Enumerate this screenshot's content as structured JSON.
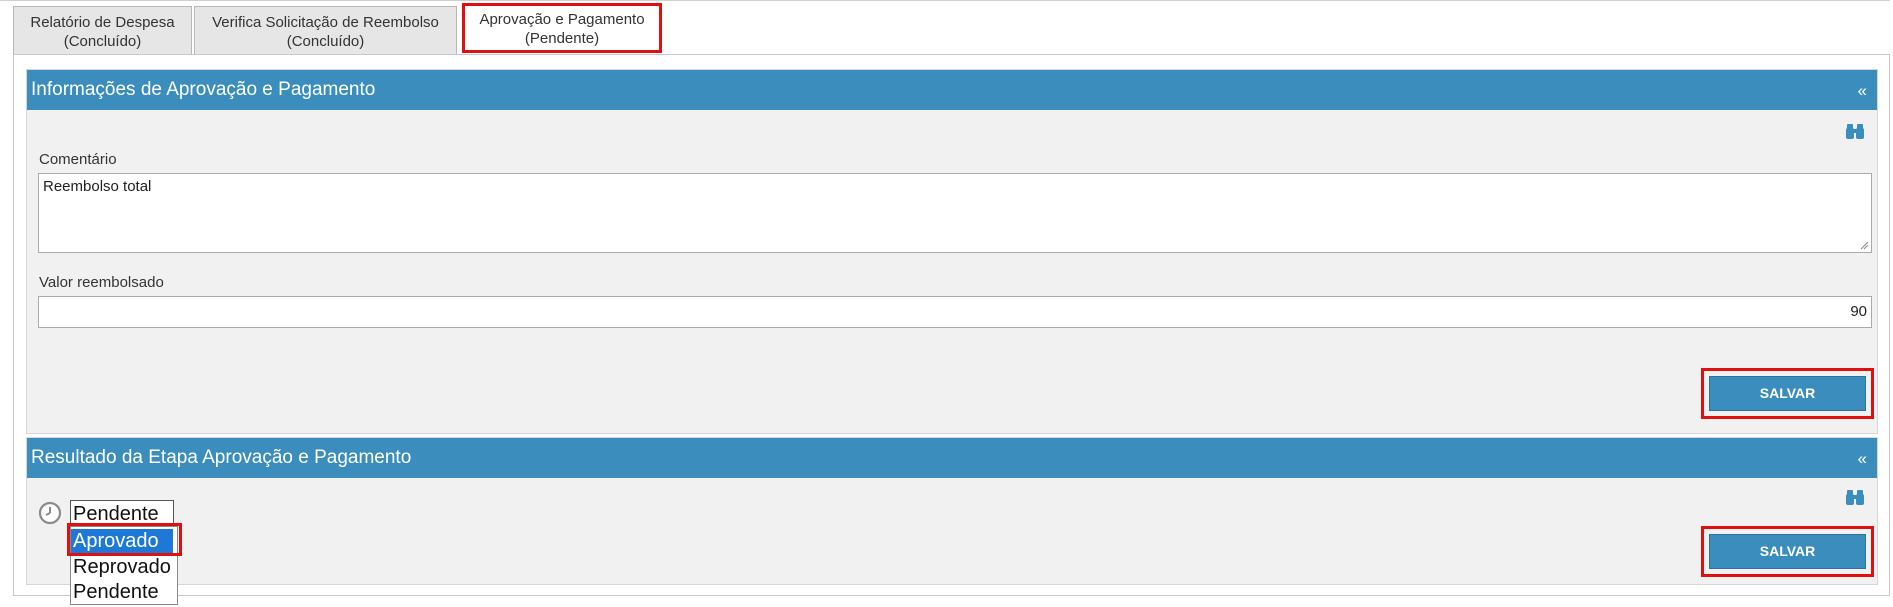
{
  "tabs": [
    {
      "line1": "Relatório de Despesa",
      "line2": "(Concluído)"
    },
    {
      "line1": "Verifica Solicitação de Reembolso",
      "line2": "(Concluído)"
    },
    {
      "line1": "Aprovação e Pagamento",
      "line2": "(Pendente)"
    }
  ],
  "approval_section": {
    "title": "Informações de Aprovação e Pagamento",
    "collapse_glyph": "«",
    "comment_label": "Comentário",
    "comment_value": "Reembolso total",
    "amount_label": "Valor reembolsado",
    "amount_value": "90",
    "save_label": "SALVAR"
  },
  "result_section": {
    "title": "Resultado da Etapa Aprovação e Pagamento",
    "collapse_glyph": "«",
    "status_selected": "Pendente",
    "status_options": [
      "Aprovado",
      "Reprovado",
      "Pendente"
    ],
    "save_label": "SALVAR"
  },
  "icons": {
    "binoculars": "binoculars-icon",
    "clock": "clock-icon"
  },
  "colors": {
    "header_bg": "#3a8dbd",
    "button_bg": "#3a8dbd",
    "highlight_border": "#e01010",
    "selected_option_bg": "#1e78d6"
  }
}
